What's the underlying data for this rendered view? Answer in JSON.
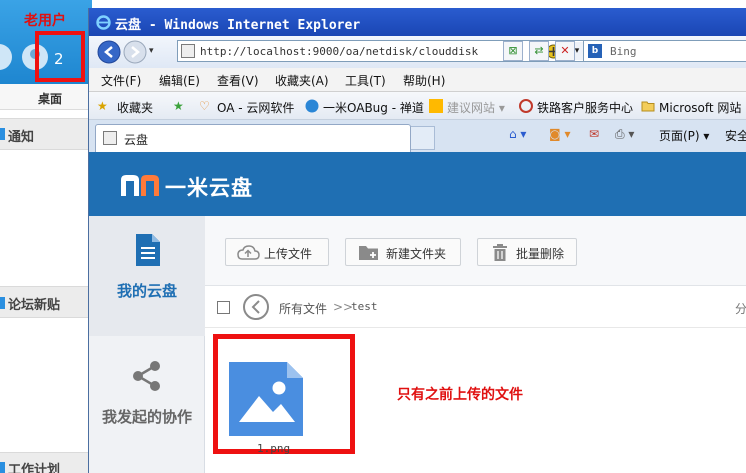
{
  "background_app": {
    "annotation_old_user": "老用户",
    "badge_count": "2",
    "desktop_label": "桌面",
    "sections": [
      "通知",
      "论坛新贴",
      "工作计划"
    ]
  },
  "window": {
    "title": "云盘 - Windows Internet Explorer",
    "address": "http://localhost:9000/oa/netdisk/clouddisk",
    "search_placeholder": "Bing",
    "search_logo": "b",
    "menu": [
      "文件(F)",
      "编辑(E)",
      "查看(V)",
      "收藏夹(A)",
      "工具(T)",
      "帮助(H)"
    ],
    "favorites_label": "收藏夹",
    "favorites": [
      "OA - 云网软件",
      "一米OABug - 禅道",
      "建议网站 ▾",
      "铁路客户服务中心",
      "Microsoft 网站"
    ],
    "tab_title": "云盘",
    "commands": [
      "页面(P) ▾",
      "安全"
    ]
  },
  "app": {
    "brand": "一米云盘",
    "nav": {
      "my_disk": "我的云盘",
      "my_collab": "我发起的协作"
    },
    "toolbar": {
      "upload": "上传文件",
      "new_folder": "新建文件夹",
      "batch_delete": "批量删除"
    },
    "breadcrumb": {
      "all_files": "所有文件",
      "sep": ">>",
      "current": "test",
      "right_label": "分"
    },
    "files": [
      {
        "name": "1.png"
      }
    ],
    "annotation": "只有之前上传的文件"
  },
  "colors": {
    "header_blue": "#1f6fb3",
    "annotation_red": "#ee1111",
    "file_icon_blue": "#4a8ee0"
  }
}
